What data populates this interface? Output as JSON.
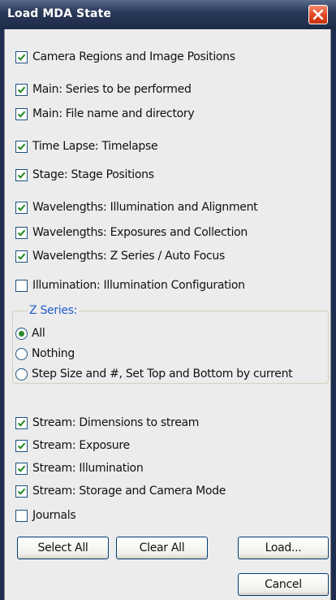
{
  "window": {
    "title": "Load MDA State"
  },
  "items": [
    {
      "label": "Camera Regions and Image Positions",
      "checked": true
    },
    {
      "label": "Main: Series to be performed",
      "checked": true
    },
    {
      "label": "Main: File name and directory",
      "checked": true
    },
    {
      "label": "Time Lapse: Timelapse",
      "checked": true
    },
    {
      "label": "Stage: Stage Positions",
      "checked": true
    },
    {
      "label": "Wavelengths: Illumination and Alignment",
      "checked": true
    },
    {
      "label": "Wavelengths: Exposures and Collection",
      "checked": true
    },
    {
      "label": "Wavelengths: Z Series / Auto Focus",
      "checked": true
    },
    {
      "label": "Illumination: Illumination Configuration",
      "checked": false
    }
  ],
  "z_series": {
    "title": "Z Series:",
    "options": [
      {
        "label": "All",
        "selected": true
      },
      {
        "label": "Nothing",
        "selected": false
      },
      {
        "label": "Step Size and #, Set Top and Bottom by current",
        "selected": false
      }
    ]
  },
  "stream_items": [
    {
      "label": "Stream: Dimensions to stream",
      "checked": true
    },
    {
      "label": "Stream: Exposure",
      "checked": true
    },
    {
      "label": "Stream: Illumination",
      "checked": true
    },
    {
      "label": "Stream: Storage and Camera Mode",
      "checked": true
    },
    {
      "label": "Journals",
      "checked": false
    }
  ],
  "buttons": {
    "select_all": "Select All",
    "clear_all": "Clear All",
    "load": "Load...",
    "cancel": "Cancel"
  },
  "icons": {
    "close": "close-icon",
    "check": "checkmark-icon"
  }
}
